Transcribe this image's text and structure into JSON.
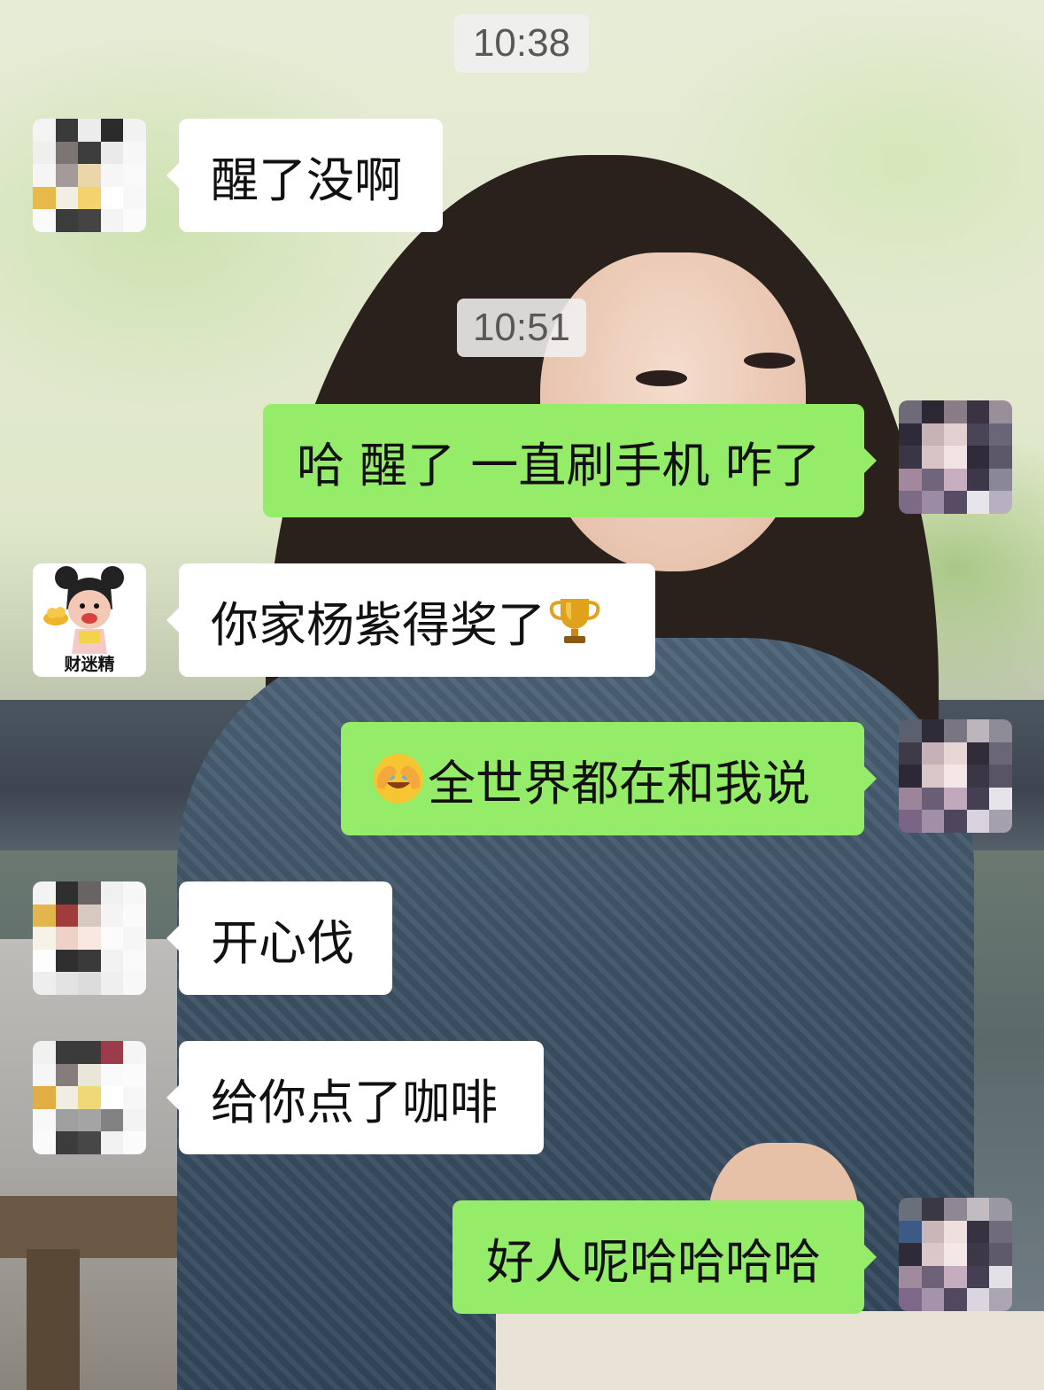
{
  "timestamps": [
    "10:38",
    "10:51"
  ],
  "messages": [
    {
      "side": "in",
      "text": "醒了没啊",
      "emoji": ""
    },
    {
      "side": "out",
      "text": "哈 醒了 一直刷手机 咋了",
      "emoji": ""
    },
    {
      "side": "in",
      "text": "你家杨紫得奖了",
      "emoji": "trophy-emoji"
    },
    {
      "side": "out",
      "text": "全世界都在和我说",
      "emoji": "crying-face-emoji"
    },
    {
      "side": "in",
      "text": "开心伐",
      "emoji": ""
    },
    {
      "side": "in",
      "text": "给你点了咖啡",
      "emoji": ""
    },
    {
      "side": "out",
      "text": "好人呢哈哈哈哈",
      "emoji": ""
    }
  ],
  "contact_avatar_label": "财迷精",
  "colors": {
    "outgoing_bubble": "#95ec69",
    "incoming_bubble": "#ffffff",
    "timestamp_bg": "#f0f0f0"
  }
}
